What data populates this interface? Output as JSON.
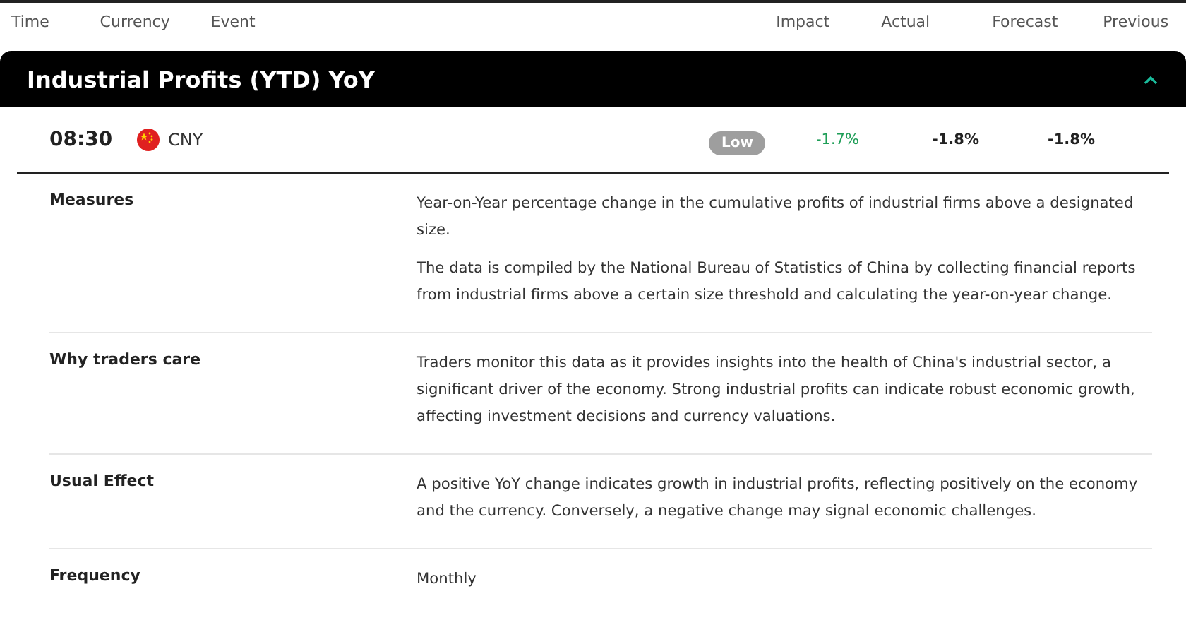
{
  "columns": [
    "Time",
    "Currency",
    "Event",
    "Impact",
    "Actual",
    "Forecast",
    "Previous"
  ],
  "event": {
    "title": "Industrial Profits (YTD) YoY",
    "expanded": true,
    "time": "08:30",
    "currency": "CNY",
    "impact": {
      "label": "Low",
      "kind": "low"
    },
    "actual": {
      "value": "-1.7%",
      "better": true
    },
    "forecast": "-1.8%",
    "previous": "-1.8%"
  },
  "details": [
    {
      "label": "Measures",
      "paragraphs": [
        "Year-on-Year percentage change in the cumulative profits of industrial firms above a designated size.",
        "The data is compiled by the National Bureau of Statistics of China by collecting financial reports from industrial firms above a certain size threshold and calculating the year-on-year change."
      ]
    },
    {
      "label": "Why traders care",
      "paragraphs": [
        "Traders monitor this data as it provides insights into the health of China's industrial sector, a significant driver of the economy. Strong industrial profits can indicate robust economic growth, affecting investment decisions and currency valuations."
      ]
    },
    {
      "label": "Usual Effect",
      "paragraphs": [
        "A positive YoY change indicates growth in industrial profits, reflecting positively on the economy and the currency. Conversely, a negative change may signal economic challenges."
      ]
    },
    {
      "label": "Frequency",
      "paragraphs": [
        "Monthly"
      ]
    }
  ]
}
